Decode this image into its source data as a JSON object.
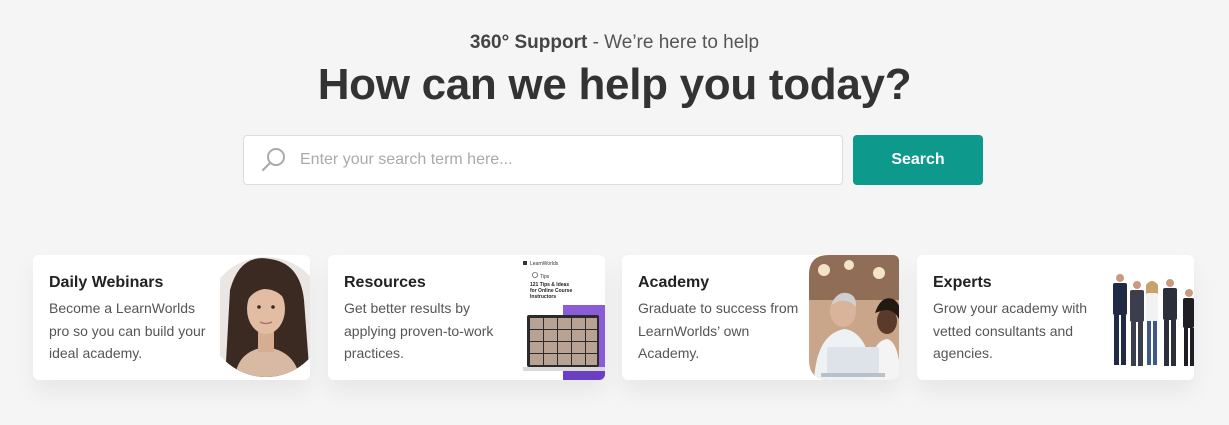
{
  "header": {
    "eyebrow_bold": "360° Support",
    "eyebrow_rest": " - We’re here to help",
    "title": "How can we help you today?"
  },
  "search": {
    "placeholder": "Enter your search term here...",
    "value": "",
    "button_label": "Search",
    "icon": "search-icon"
  },
  "colors": {
    "accent": "#0d9a8c",
    "background": "#f5f5f5",
    "card_background": "#ffffff"
  },
  "cards": [
    {
      "title": "Daily Webinars",
      "description": "Become a LearnWorlds pro so you can build your ideal academy.",
      "image": "presenter-portrait"
    },
    {
      "title": "Resources",
      "description": "Get better results by applying proven-to-work practices.",
      "image": "ebook-cover",
      "ebook": {
        "brand": "LearnWorlds",
        "tag": "Tips",
        "title_lines": [
          "121 Tips & Ideas",
          "for Online Course",
          "Instructors"
        ]
      }
    },
    {
      "title": "Academy",
      "description": "Graduate to success from LearnWorlds’ own Academy.",
      "image": "students-at-laptop"
    },
    {
      "title": "Experts",
      "description": "Grow your academy with vetted consultants and agencies.",
      "image": "team-of-experts"
    }
  ]
}
